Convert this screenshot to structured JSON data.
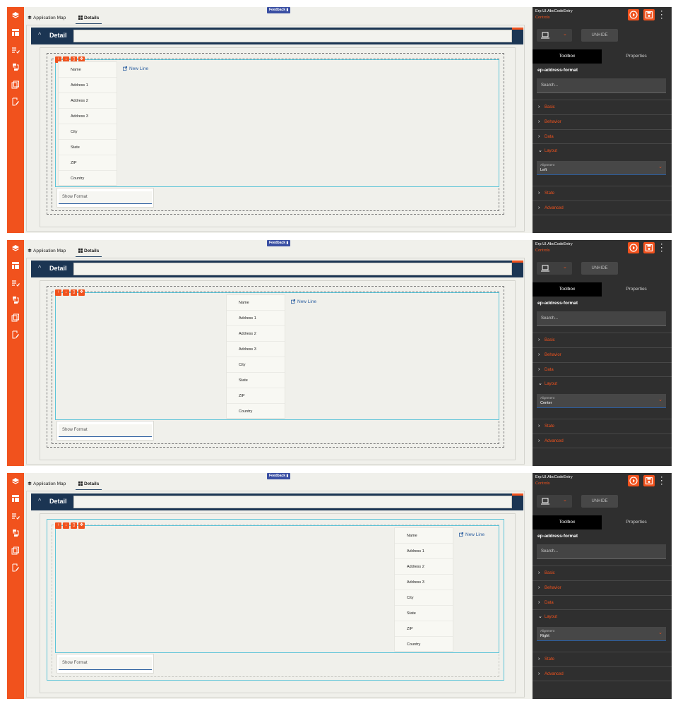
{
  "left_nav": {
    "icons": [
      "layers-icon",
      "layout-icon",
      "list-check-icon",
      "flow-icon",
      "pages-icon",
      "edit-doc-icon"
    ]
  },
  "tabs": {
    "app_map": "Application Map",
    "details": "Details"
  },
  "feedback": {
    "label": "Feedback"
  },
  "detail": {
    "title": "Detail",
    "chevron": "^"
  },
  "control_buttons": [
    "↑",
    "↓",
    "▯",
    "✥"
  ],
  "address_fields": [
    "Name",
    "Address 1",
    "Address 2",
    "Address 3",
    "City",
    "State",
    "ZIP",
    "Country"
  ],
  "new_line": {
    "label": "New Line"
  },
  "show_format": {
    "placeholder": "Show Format"
  },
  "right_panel": {
    "component_name": "Erp.UI.AbcCodeEntry",
    "component_sub": "Controls",
    "unhide": "UNHIDE",
    "tabs": {
      "toolbox": "Toolbox",
      "properties": "Properties"
    },
    "selected_control": "ep-address-format",
    "search_placeholder": "Search...",
    "sections": {
      "basic": "Basic",
      "behavior": "Behavior",
      "data": "Data",
      "layout": "Layout",
      "state": "State",
      "advanced": "Advanced"
    },
    "alignment_label": "Alignment"
  },
  "panels": [
    {
      "alignment": "Left"
    },
    {
      "alignment": "Center"
    },
    {
      "alignment": "Right"
    }
  ],
  "colors": {
    "brand_orange": "#f1521d",
    "detail_navy": "#1b3553",
    "selection_cyan": "#5cc4d8",
    "link_blue": "#2b5ea0",
    "right_panel_bg": "#2f2f2f"
  }
}
